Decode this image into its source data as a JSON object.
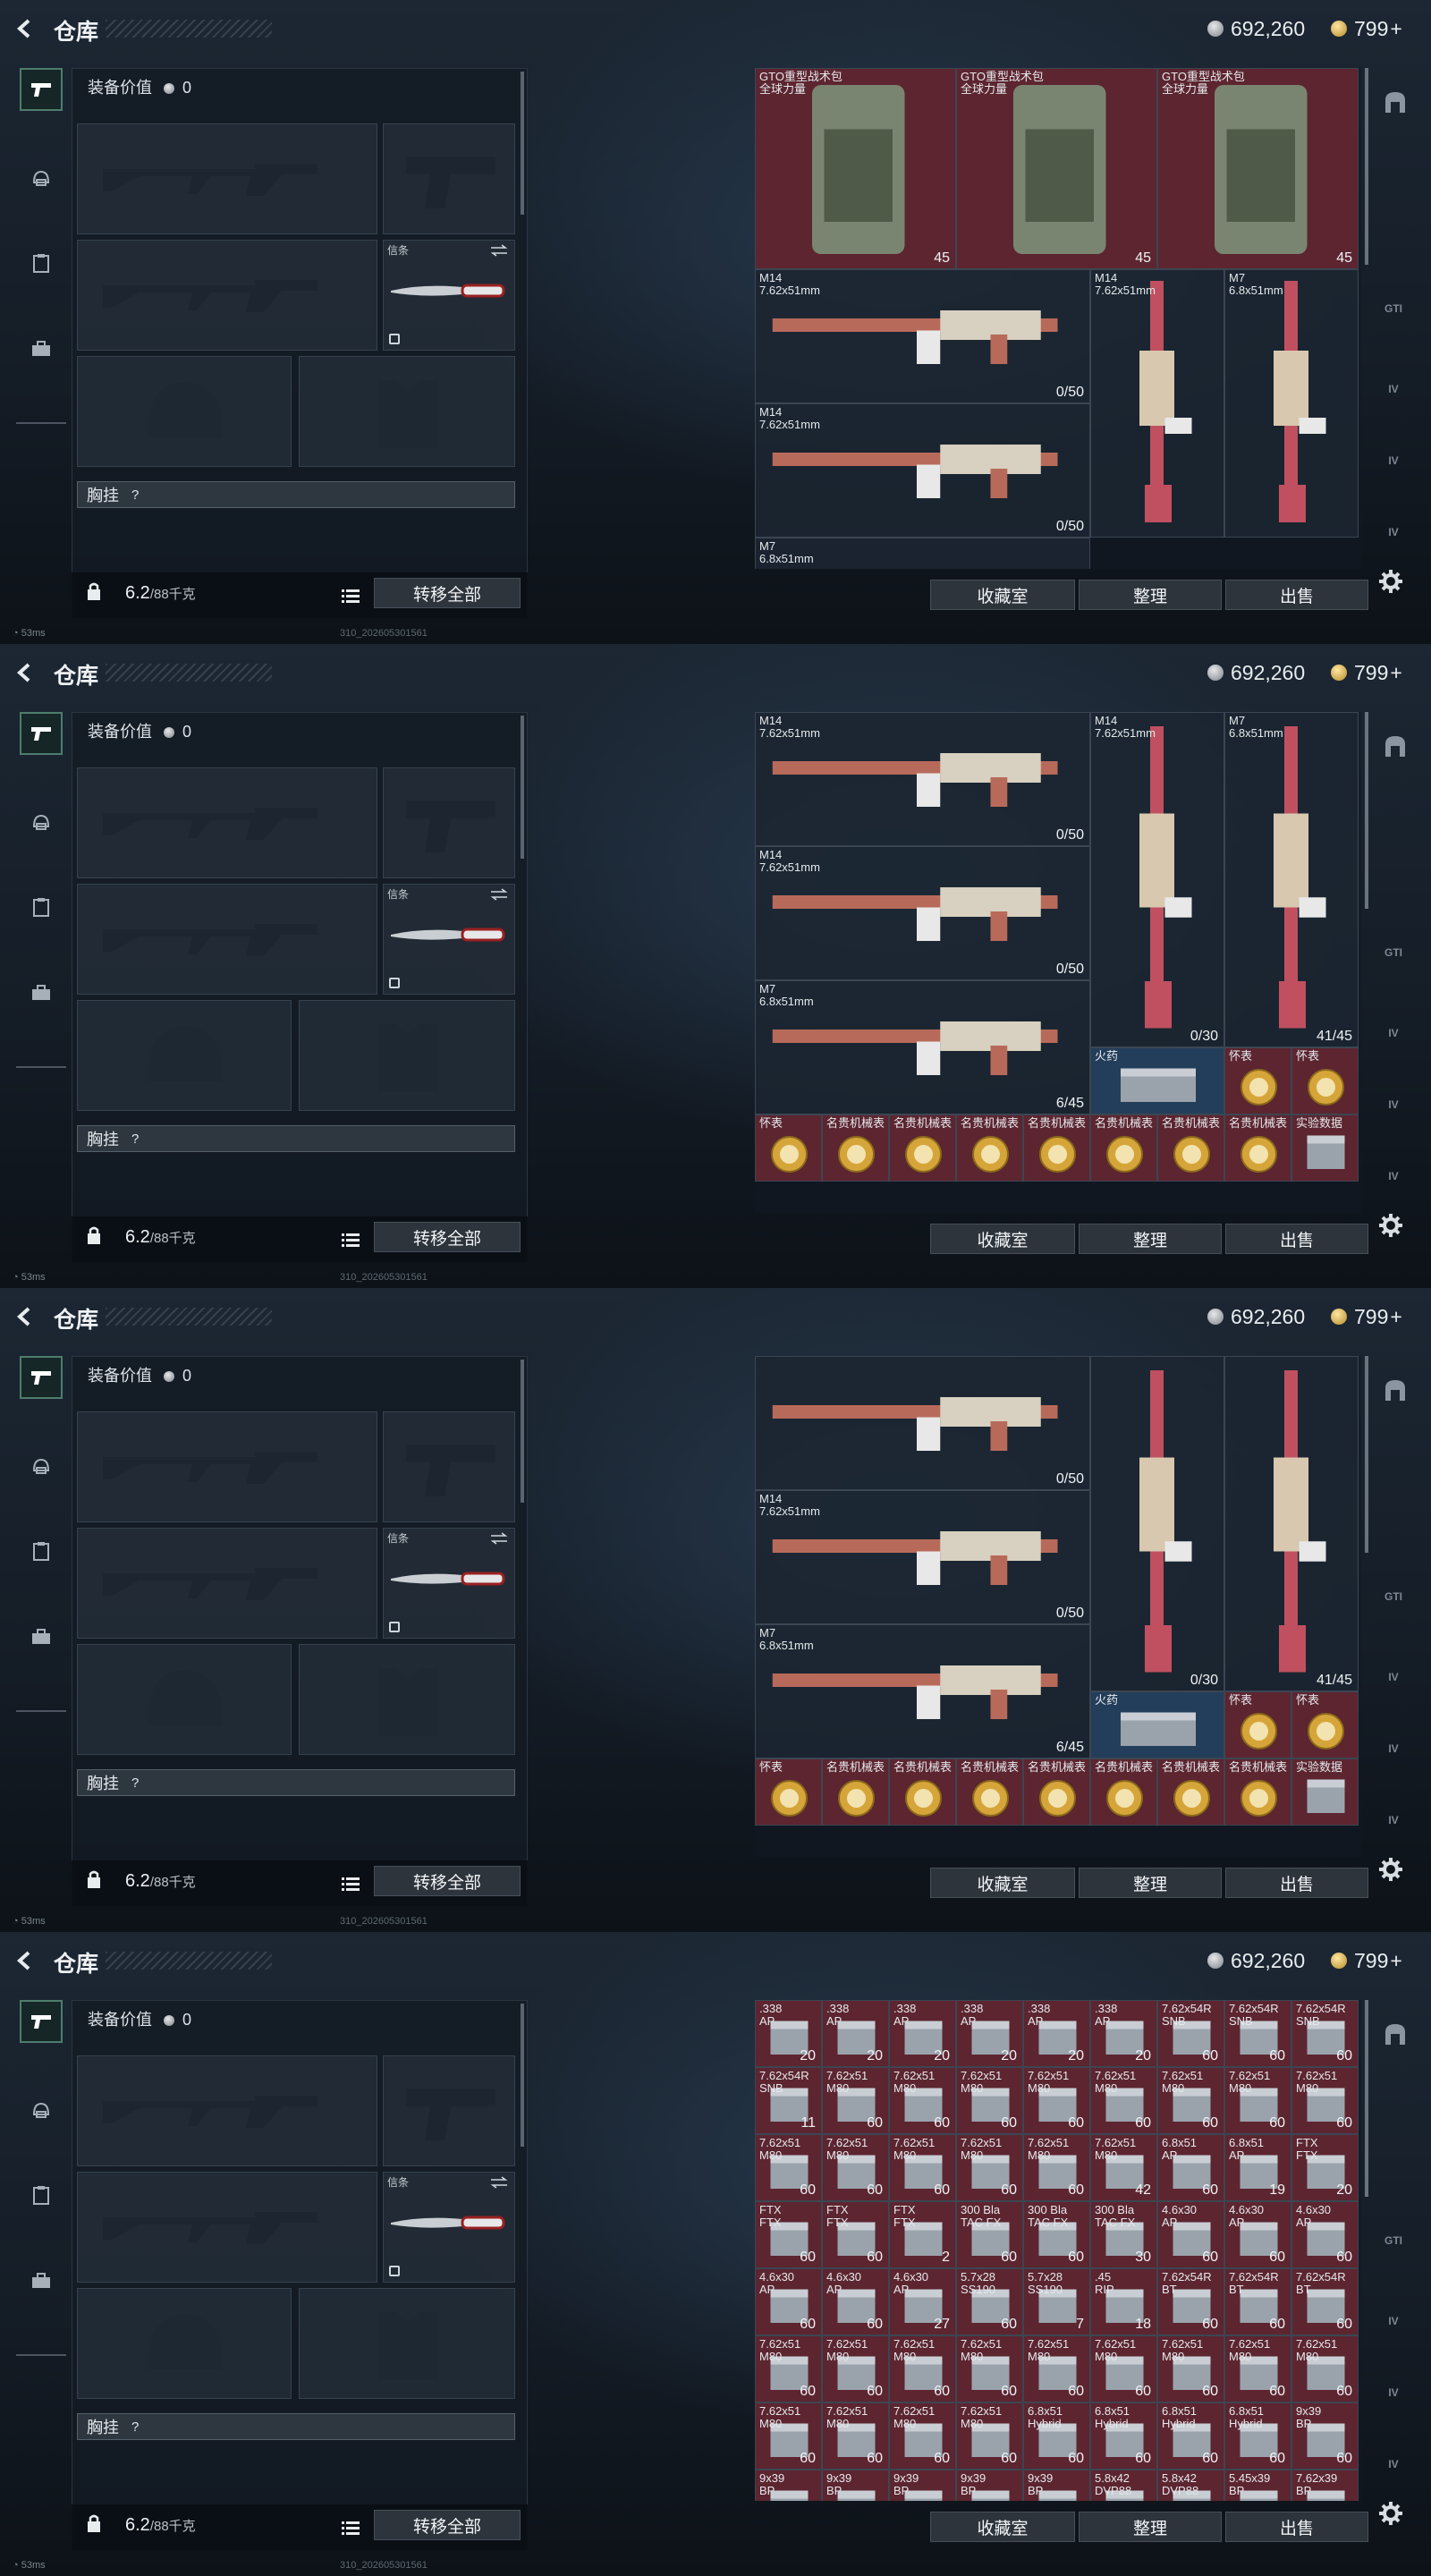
{
  "header": {
    "title": "仓库",
    "currency_silver": "692,260",
    "currency_gold": "799",
    "gold_plus": "+"
  },
  "equipment": {
    "value_label": "装备价值",
    "value": "0",
    "knife_label": "信条",
    "chest_label": "胸挂",
    "chest_help": "?",
    "weight_current": "6.2",
    "weight_max": "/88千克",
    "transfer_all": "转移全部"
  },
  "actions": {
    "collection": "收藏室",
    "sort": "整理",
    "sell": "出售"
  },
  "status": {
    "ping": "53ms",
    "build": "310_202605301561"
  },
  "right_nav": [
    "GTI",
    "GTI",
    "IV",
    "IV",
    "IV"
  ],
  "frames": [
    {
      "cells": [
        {
          "c": 0,
          "r": 0,
          "w": 3,
          "h": 3,
          "name": "GTO重型战术包\n全球力量",
          "count": "45",
          "bg": "red",
          "icon": "bag"
        },
        {
          "c": 3,
          "r": 0,
          "w": 3,
          "h": 3,
          "name": "GTO重型战术包\n全球力量",
          "count": "45",
          "bg": "red",
          "icon": "bag"
        },
        {
          "c": 6,
          "r": 0,
          "w": 3,
          "h": 3,
          "name": "GTO重型战术包\n全球力量",
          "count": "45",
          "bg": "red",
          "icon": "bag"
        },
        {
          "c": 0,
          "r": 3,
          "w": 5,
          "h": 2,
          "name": "M14\n7.62x51mm",
          "count": "0/50",
          "bg": "norm",
          "icon": "gun"
        },
        {
          "c": 5,
          "r": 3,
          "w": 2,
          "h": 4,
          "name": "M14\n7.62x51mm",
          "count": "",
          "bg": "norm",
          "icon": "vgun"
        },
        {
          "c": 7,
          "r": 3,
          "w": 2,
          "h": 4,
          "name": "M7\n6.8x51mm",
          "count": "",
          "bg": "norm",
          "icon": "vgun"
        },
        {
          "c": 0,
          "r": 5,
          "w": 5,
          "h": 2,
          "name": "M14\n7.62x51mm",
          "count": "0/50",
          "bg": "norm",
          "icon": "gun"
        },
        {
          "c": 0,
          "r": 7,
          "w": 5,
          "h": 2,
          "name": "M7\n6.8x51mm",
          "count": "",
          "bg": "norm",
          "icon": "gun"
        }
      ]
    },
    {
      "cells": [
        {
          "c": 0,
          "r": 0,
          "w": 5,
          "h": 2,
          "name": "M14\n7.62x51mm",
          "count": "0/50",
          "bg": "norm",
          "icon": "gun"
        },
        {
          "c": 5,
          "r": 0,
          "w": 2,
          "h": 5,
          "name": "M14\n7.62x51mm",
          "count": "0/30",
          "bg": "norm",
          "icon": "vgun"
        },
        {
          "c": 7,
          "r": 0,
          "w": 2,
          "h": 5,
          "name": "M7\n6.8x51mm",
          "count": "41/45",
          "bg": "norm",
          "icon": "vgun"
        },
        {
          "c": 0,
          "r": 2,
          "w": 5,
          "h": 2,
          "name": "M14\n7.62x51mm",
          "count": "0/50",
          "bg": "norm",
          "icon": "gun"
        },
        {
          "c": 0,
          "r": 4,
          "w": 5,
          "h": 2,
          "name": "M7\n6.8x51mm",
          "count": "6/45",
          "bg": "norm",
          "icon": "gun"
        },
        {
          "c": 5,
          "r": 5,
          "w": 2,
          "h": 1,
          "name": "火药",
          "count": "",
          "bg": "blue",
          "icon": "box"
        },
        {
          "c": 7,
          "r": 5,
          "w": 1,
          "h": 1,
          "name": "怀表",
          "count": "",
          "bg": "red",
          "icon": "watch"
        },
        {
          "c": 8,
          "r": 5,
          "w": 1,
          "h": 1,
          "name": "怀表",
          "count": "",
          "bg": "red",
          "icon": "watch"
        },
        {
          "c": 0,
          "r": 6,
          "w": 1,
          "h": 1,
          "name": "怀表",
          "count": "",
          "bg": "red",
          "icon": "watch"
        },
        {
          "c": 1,
          "r": 6,
          "w": 1,
          "h": 1,
          "name": "名贵机械表",
          "count": "",
          "bg": "red",
          "icon": "watch"
        },
        {
          "c": 2,
          "r": 6,
          "w": 1,
          "h": 1,
          "name": "名贵机械表",
          "count": "",
          "bg": "red",
          "icon": "watch"
        },
        {
          "c": 3,
          "r": 6,
          "w": 1,
          "h": 1,
          "name": "名贵机械表",
          "count": "",
          "bg": "red",
          "icon": "watch"
        },
        {
          "c": 4,
          "r": 6,
          "w": 1,
          "h": 1,
          "name": "名贵机械表",
          "count": "",
          "bg": "red",
          "icon": "watch"
        },
        {
          "c": 5,
          "r": 6,
          "w": 1,
          "h": 1,
          "name": "名贵机械表",
          "count": "",
          "bg": "red",
          "icon": "watch"
        },
        {
          "c": 6,
          "r": 6,
          "w": 1,
          "h": 1,
          "name": "名贵机械表",
          "count": "",
          "bg": "red",
          "icon": "watch"
        },
        {
          "c": 7,
          "r": 6,
          "w": 1,
          "h": 1,
          "name": "名贵机械表",
          "count": "",
          "bg": "red",
          "icon": "watch"
        },
        {
          "c": 8,
          "r": 6,
          "w": 1,
          "h": 1,
          "name": "实验数据",
          "count": "",
          "bg": "red",
          "icon": "box"
        }
      ]
    },
    {
      "cells": [
        {
          "c": 0,
          "r": 0,
          "w": 5,
          "h": 2,
          "name": "",
          "count": "0/50",
          "bg": "norm",
          "icon": "gun"
        },
        {
          "c": 5,
          "r": 0,
          "w": 2,
          "h": 5,
          "name": "",
          "count": "0/30",
          "bg": "norm",
          "icon": "vgun"
        },
        {
          "c": 7,
          "r": 0,
          "w": 2,
          "h": 5,
          "name": "",
          "count": "41/45",
          "bg": "norm",
          "icon": "vgun"
        },
        {
          "c": 0,
          "r": 2,
          "w": 5,
          "h": 2,
          "name": "M14\n7.62x51mm",
          "count": "0/50",
          "bg": "norm",
          "icon": "gun"
        },
        {
          "c": 0,
          "r": 4,
          "w": 5,
          "h": 2,
          "name": "M7\n6.8x51mm",
          "count": "6/45",
          "bg": "norm",
          "icon": "gun"
        },
        {
          "c": 5,
          "r": 5,
          "w": 2,
          "h": 1,
          "name": "火药",
          "count": "",
          "bg": "blue",
          "icon": "box"
        },
        {
          "c": 7,
          "r": 5,
          "w": 1,
          "h": 1,
          "name": "怀表",
          "count": "",
          "bg": "red",
          "icon": "watch"
        },
        {
          "c": 8,
          "r": 5,
          "w": 1,
          "h": 1,
          "name": "怀表",
          "count": "",
          "bg": "red",
          "icon": "watch"
        },
        {
          "c": 0,
          "r": 6,
          "w": 1,
          "h": 1,
          "name": "怀表",
          "count": "",
          "bg": "red",
          "icon": "watch"
        },
        {
          "c": 1,
          "r": 6,
          "w": 1,
          "h": 1,
          "name": "名贵机械表",
          "count": "",
          "bg": "red",
          "icon": "watch"
        },
        {
          "c": 2,
          "r": 6,
          "w": 1,
          "h": 1,
          "name": "名贵机械表",
          "count": "",
          "bg": "red",
          "icon": "watch"
        },
        {
          "c": 3,
          "r": 6,
          "w": 1,
          "h": 1,
          "name": "名贵机械表",
          "count": "",
          "bg": "red",
          "icon": "watch"
        },
        {
          "c": 4,
          "r": 6,
          "w": 1,
          "h": 1,
          "name": "名贵机械表",
          "count": "",
          "bg": "red",
          "icon": "watch"
        },
        {
          "c": 5,
          "r": 6,
          "w": 1,
          "h": 1,
          "name": "名贵机械表",
          "count": "",
          "bg": "red",
          "icon": "watch"
        },
        {
          "c": 6,
          "r": 6,
          "w": 1,
          "h": 1,
          "name": "名贵机械表",
          "count": "",
          "bg": "red",
          "icon": "watch"
        },
        {
          "c": 7,
          "r": 6,
          "w": 1,
          "h": 1,
          "name": "名贵机械表",
          "count": "",
          "bg": "red",
          "icon": "watch"
        },
        {
          "c": 8,
          "r": 6,
          "w": 1,
          "h": 1,
          "name": "实验数据",
          "count": "",
          "bg": "red",
          "icon": "box"
        }
      ]
    },
    {
      "ammo_rows": [
        [
          [
            ".338\nAP",
            "20"
          ],
          [
            ".338\nAP",
            "20"
          ],
          [
            ".338\nAP",
            "20"
          ],
          [
            ".338\nAP",
            "20"
          ],
          [
            ".338\nAP",
            "20"
          ],
          [
            ".338\nAP",
            "20"
          ],
          [
            "7.62x54R\nSNB",
            "60"
          ],
          [
            "7.62x54R\nSNB",
            "60"
          ],
          [
            "7.62x54R\nSNB",
            "60"
          ]
        ],
        [
          [
            "7.62x54R\nSNB",
            "11"
          ],
          [
            "7.62x51\nM80",
            "60"
          ],
          [
            "7.62x51\nM80",
            "60"
          ],
          [
            "7.62x51\nM80",
            "60"
          ],
          [
            "7.62x51\nM80",
            "60"
          ],
          [
            "7.62x51\nM80",
            "60"
          ],
          [
            "7.62x51\nM80",
            "60"
          ],
          [
            "7.62x51\nM80",
            "60"
          ],
          [
            "7.62x51\nM80",
            "60"
          ]
        ],
        [
          [
            "7.62x51\nM80",
            "60"
          ],
          [
            "7.62x51\nM80",
            "60"
          ],
          [
            "7.62x51\nM80",
            "60"
          ],
          [
            "7.62x51\nM80",
            "60"
          ],
          [
            "7.62x51\nM80",
            "60"
          ],
          [
            "7.62x51\nM80",
            "42"
          ],
          [
            "6.8x51\nAP",
            "60"
          ],
          [
            "6.8x51\nAP",
            "19"
          ],
          [
            "FTX\nFTX",
            "20"
          ]
        ],
        [
          [
            "FTX\nFTX",
            "60"
          ],
          [
            "FTX\nFTX",
            "60"
          ],
          [
            "FTX\nFTX",
            "2"
          ],
          [
            "300 Bla\nTAC FX",
            "60"
          ],
          [
            "300 Bla\nTAC FX",
            "60"
          ],
          [
            "300 Bla\nTAC FX",
            "30"
          ],
          [
            "4.6x30\nAP",
            "60"
          ],
          [
            "4.6x30\nAP",
            "60"
          ],
          [
            "4.6x30\nAP",
            "60"
          ]
        ],
        [
          [
            "4.6x30\nAP",
            "60"
          ],
          [
            "4.6x30\nAP",
            "60"
          ],
          [
            "4.6x30\nAP",
            "27"
          ],
          [
            "5.7x28\nSS190",
            "60"
          ],
          [
            "5.7x28\nSS190",
            "7"
          ],
          [
            ".45\nRIP",
            "18"
          ],
          [
            "7.62x54R\nBT",
            "60"
          ],
          [
            "7.62x54R\nBT",
            "60"
          ],
          [
            "7.62x54R\nBT",
            "60"
          ]
        ],
        [
          [
            "7.62x51\nM80",
            "60"
          ],
          [
            "7.62x51\nM80",
            "60"
          ],
          [
            "7.62x51\nM80",
            "60"
          ],
          [
            "7.62x51\nM80",
            "60"
          ],
          [
            "7.62x51\nM80",
            "60"
          ],
          [
            "7.62x51\nM80",
            "60"
          ],
          [
            "7.62x51\nM80",
            "60"
          ],
          [
            "7.62x51\nM80",
            "60"
          ],
          [
            "7.62x51\nM80",
            "60"
          ]
        ],
        [
          [
            "7.62x51\nM80",
            "60"
          ],
          [
            "7.62x51\nM80",
            "60"
          ],
          [
            "7.62x51\nM80",
            "60"
          ],
          [
            "7.62x51\nM80",
            "60"
          ],
          [
            "6.8x51\nHybrid",
            "60"
          ],
          [
            "6.8x51\nHybrid",
            "60"
          ],
          [
            "6.8x51\nHybrid",
            "60"
          ],
          [
            "6.8x51\nHybrid",
            "60"
          ],
          [
            "9x39\nBP",
            "60"
          ]
        ],
        [
          [
            "9x39\nBP",
            ""
          ],
          [
            "9x39\nBP",
            ""
          ],
          [
            "9x39\nBP",
            ""
          ],
          [
            "9x39\nBP",
            ""
          ],
          [
            "9x39\nBP",
            ""
          ],
          [
            "5.8x42\nDVP88",
            ""
          ],
          [
            "5.8x42\nDVP88",
            ""
          ],
          [
            "5.45x39\nBP",
            ""
          ],
          [
            "7.62x39\nBP",
            ""
          ]
        ]
      ]
    }
  ]
}
